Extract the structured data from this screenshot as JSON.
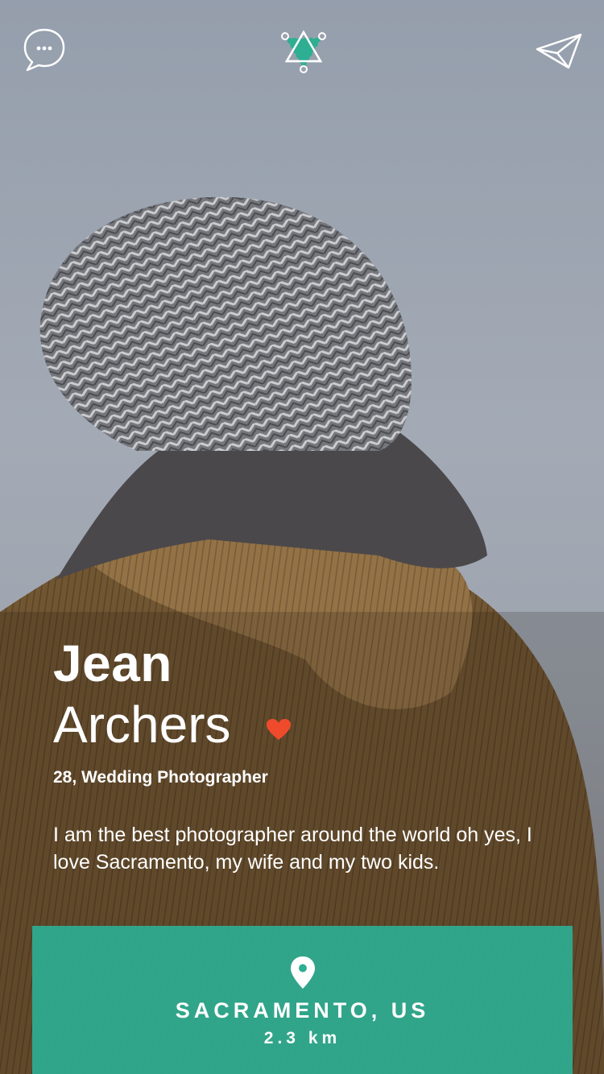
{
  "header": {
    "left_icon": "chat-bubble-icon",
    "center_icon": "star-logo-icon",
    "right_icon": "paper-plane-icon"
  },
  "profile": {
    "first_name": "Jean",
    "last_name": "Archers",
    "favorite_icon": "heart-icon",
    "subtitle": "28, Wedding Photographer",
    "bio": "I am the best photographer around the world oh yes, I love Sacramento, my wife and my two kids."
  },
  "location": {
    "icon": "map-pin-icon",
    "city": "SACRAMENTO, US",
    "distance": "2.3 km"
  },
  "colors": {
    "accent": "#2eae92",
    "heart": "#f04a2c",
    "background": "#9aa2ae"
  }
}
